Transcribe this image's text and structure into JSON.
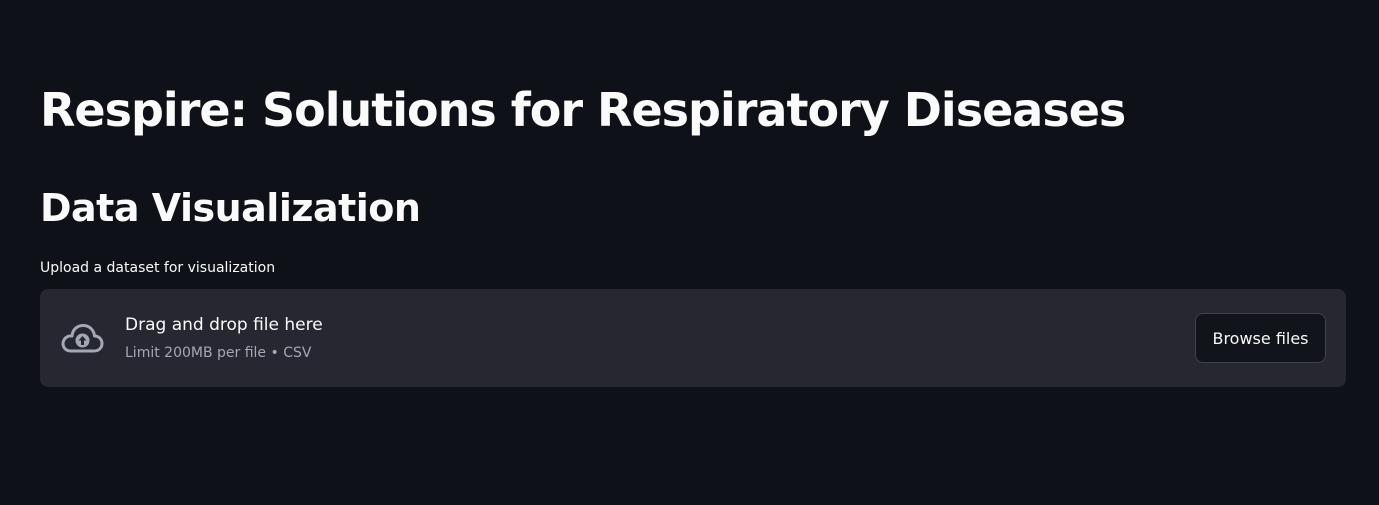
{
  "page": {
    "title": "Respire: Solutions for Respiratory Diseases",
    "section_title": "Data Visualization"
  },
  "uploader": {
    "label": "Upload a dataset for visualization",
    "drop_title": "Drag and drop file here",
    "limit_text": "Limit 200MB per file • CSV",
    "browse_label": "Browse files",
    "icon": "cloud-upload-icon"
  },
  "colors": {
    "background": "#0e1117",
    "dropzone": "#262730",
    "text": "#fafafa",
    "muted_text": "#a3a8b4"
  }
}
